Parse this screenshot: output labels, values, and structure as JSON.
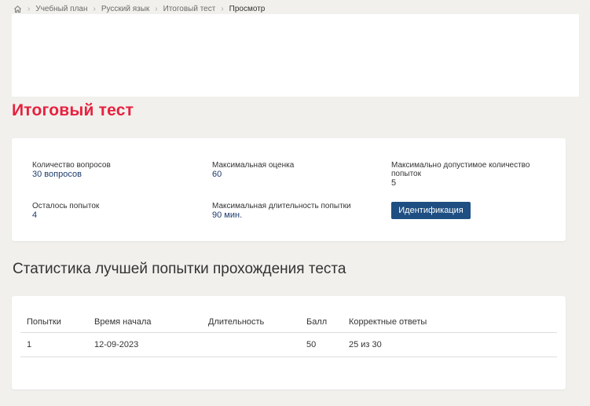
{
  "breadcrumb": {
    "home_icon": "home-icon",
    "separator_icon": "chevron-right-icon",
    "items": [
      {
        "label": "Учебный план"
      },
      {
        "label": "Русский язык"
      },
      {
        "label": "Итоговый тест"
      },
      {
        "label": "Просмотр"
      }
    ]
  },
  "page": {
    "title": "Итоговый тест",
    "title_color": "#e8213f"
  },
  "info": {
    "questions_label": "Количество вопросов",
    "questions_value": "30 вопросов",
    "max_score_label": "Максимальная оценка",
    "max_score_value": "60",
    "max_attempts_label": "Максимально допустимое количество попыток",
    "max_attempts_value": "5",
    "remaining_label": "Осталось попыток",
    "remaining_value": "4",
    "max_duration_label": "Максимальная длительность попытки",
    "max_duration_value": "90 мин.",
    "identify_button": "Идентификация",
    "button_color": "#1f4f82"
  },
  "stats": {
    "title": "Статистика лучшей попытки прохождения теста",
    "columns": [
      "Попытки",
      "Время начала",
      "Длительность",
      "Балл",
      "Корректные ответы"
    ],
    "rows": [
      [
        "1",
        "12-09-2023",
        "",
        "50",
        "25 из 30"
      ]
    ]
  }
}
